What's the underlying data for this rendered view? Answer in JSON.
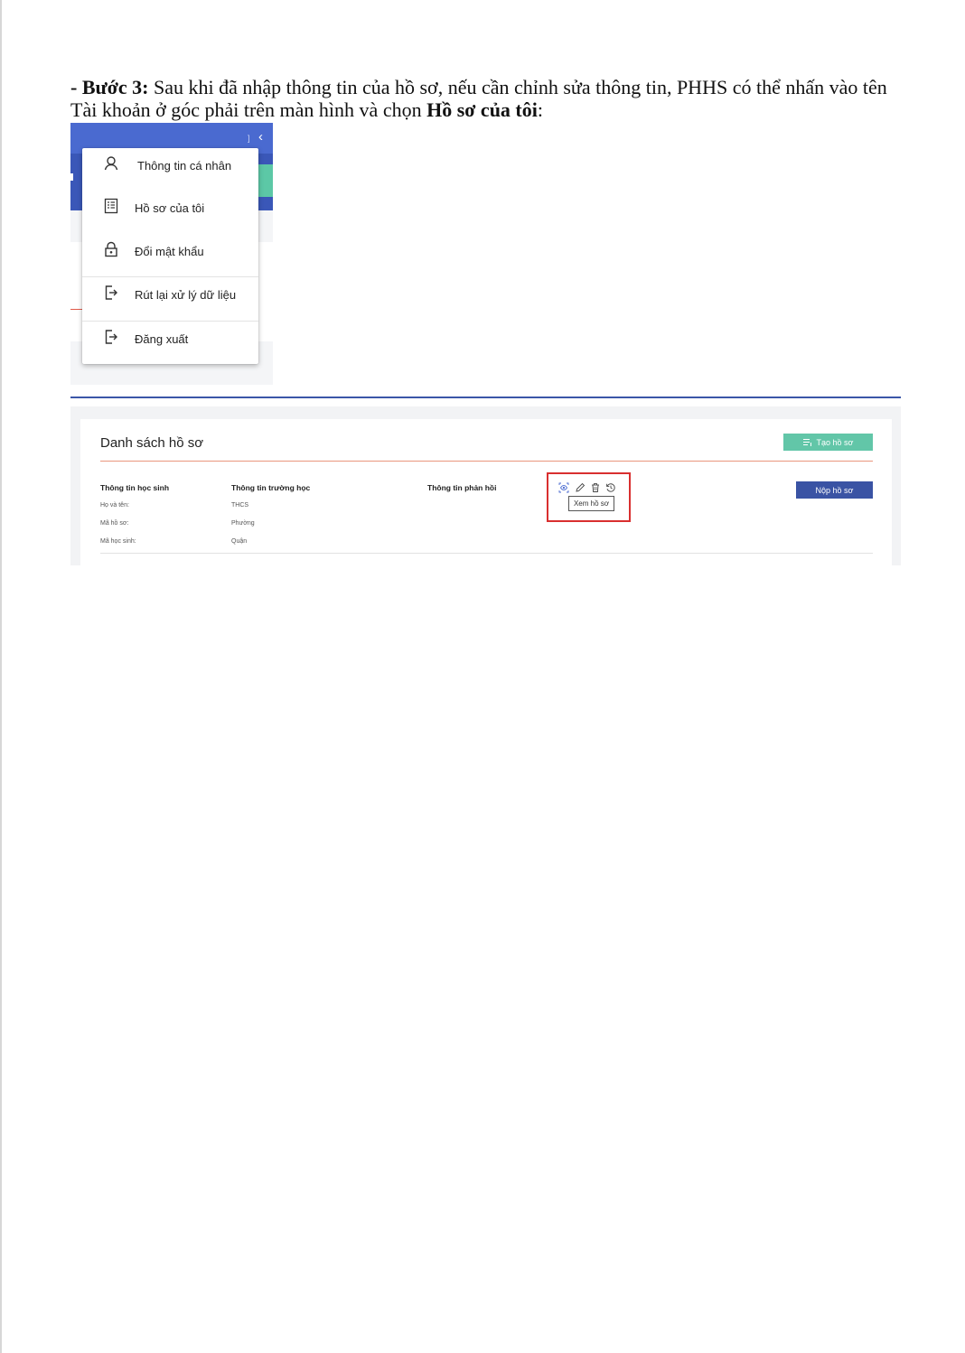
{
  "instruction": {
    "step_label": "- Bước 3:",
    "text_before": " Sau khi đã nhập thông tin của hồ sơ, nếu cần chỉnh sửa thông tin, PHHS có thể nhấn vào tên Tài khoản ở góc phải trên màn hình và chọn ",
    "emphasis": "Hồ sơ của tôi",
    "text_after": ":"
  },
  "account_menu": {
    "items": [
      {
        "label": "Thông tin cá nhân",
        "icon": "person-icon"
      },
      {
        "label": "Hồ sơ của tôi",
        "icon": "document-list-icon"
      },
      {
        "label": "Đổi mật khẩu",
        "icon": "lock-icon"
      },
      {
        "label": "Rút lại xử lý dữ liệu",
        "icon": "exit-icon"
      },
      {
        "label": "Đăng xuất",
        "icon": "logout-icon"
      }
    ],
    "colors": {
      "header": "#4a6ad0",
      "accent": "#5cc8a6"
    }
  },
  "profile_list": {
    "title": "Danh sách hồ sơ",
    "create_button": "Tạo hồ sơ",
    "submit_button": "Nộp hồ sơ",
    "columns": [
      "Thông tin học sinh",
      "Thông tin trường học",
      "Thông tin phản hồi"
    ],
    "student_fields": [
      "Họ và tên:",
      "Mã hồ sơ:",
      "Mã học sinh:"
    ],
    "school_fields": [
      "THCS",
      "Phường",
      "Quận"
    ],
    "action_icons": [
      "view-icon",
      "edit-icon",
      "delete-icon",
      "history-icon"
    ],
    "tooltip": "Xem hồ sơ",
    "colors": {
      "create": "#62c6a8",
      "submit": "#3a53a4",
      "highlight": "#d92f2f"
    }
  }
}
